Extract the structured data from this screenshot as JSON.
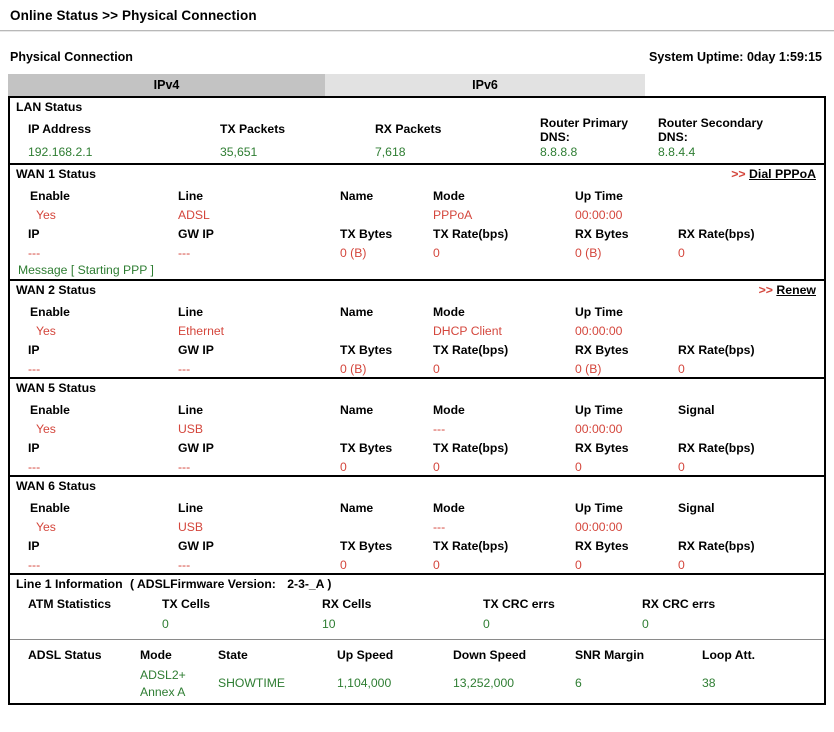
{
  "breadcrumb": "Online Status >> Physical Connection",
  "header": {
    "section_title": "Physical Connection",
    "uptime_label": "System Uptime: 0day 1:59:15"
  },
  "tabs": [
    {
      "label": "IPv4",
      "active": true
    },
    {
      "label": "IPv6",
      "active": false
    }
  ],
  "lan": {
    "title": "LAN Status",
    "headers": {
      "ip": "IP Address",
      "tx_packets": "TX Packets",
      "rx_packets": "RX Packets",
      "dns1": "Router Primary DNS:",
      "dns2": "Router Secondary DNS:"
    },
    "values": {
      "ip": "192.168.2.1",
      "tx_packets": "35,651",
      "rx_packets": "7,618",
      "dns1": "8.8.8.8",
      "dns2": "8.8.4.4"
    }
  },
  "wan1": {
    "title": "WAN 1 Status",
    "link_arrows": ">>",
    "link_text": "Dial PPPoA",
    "headers": {
      "enable": "Enable",
      "line": "Line",
      "name": "Name",
      "mode": "Mode",
      "uptime": "Up Time",
      "ip": "IP",
      "gwip": "GW IP",
      "tx_bytes": "TX Bytes",
      "tx_rate": "TX Rate(bps)",
      "rx_bytes": "RX Bytes",
      "rx_rate": "RX Rate(bps)"
    },
    "values": {
      "enable": "Yes",
      "line": "ADSL",
      "name": "",
      "mode": "PPPoA",
      "uptime": "00:00:00",
      "ip": "---",
      "gwip": "---",
      "tx_bytes": "0 (B)",
      "tx_rate": "0",
      "rx_bytes": "0 (B)",
      "rx_rate": "0"
    },
    "message": "Message [ Starting PPP ]"
  },
  "wan2": {
    "title": "WAN 2 Status",
    "link_arrows": ">>",
    "link_text": "Renew",
    "headers": {
      "enable": "Enable",
      "line": "Line",
      "name": "Name",
      "mode": "Mode",
      "uptime": "Up Time",
      "ip": "IP",
      "gwip": "GW IP",
      "tx_bytes": "TX Bytes",
      "tx_rate": "TX Rate(bps)",
      "rx_bytes": "RX Bytes",
      "rx_rate": "RX Rate(bps)"
    },
    "values": {
      "enable": "Yes",
      "line": "Ethernet",
      "name": "",
      "mode": "DHCP Client",
      "uptime": "00:00:00",
      "ip": "---",
      "gwip": "---",
      "tx_bytes": "0 (B)",
      "tx_rate": "0",
      "rx_bytes": "0 (B)",
      "rx_rate": "0"
    }
  },
  "wan5": {
    "title": "WAN 5 Status",
    "headers": {
      "enable": "Enable",
      "line": "Line",
      "name": "Name",
      "mode": "Mode",
      "uptime": "Up Time",
      "signal": "Signal",
      "ip": "IP",
      "gwip": "GW IP",
      "tx_bytes": "TX Bytes",
      "tx_rate": "TX Rate(bps)",
      "rx_bytes": "RX Bytes",
      "rx_rate": "RX Rate(bps)"
    },
    "values": {
      "enable": "Yes",
      "line": "USB",
      "name": "",
      "mode": "---",
      "uptime": "00:00:00",
      "signal": "",
      "ip": "---",
      "gwip": "---",
      "tx_bytes": "0",
      "tx_rate": "0",
      "rx_bytes": "0",
      "rx_rate": "0"
    }
  },
  "wan6": {
    "title": "WAN 6 Status",
    "headers": {
      "enable": "Enable",
      "line": "Line",
      "name": "Name",
      "mode": "Mode",
      "uptime": "Up Time",
      "signal": "Signal",
      "ip": "IP",
      "gwip": "GW IP",
      "tx_bytes": "TX Bytes",
      "tx_rate": "TX Rate(bps)",
      "rx_bytes": "RX Bytes",
      "rx_rate": "RX Rate(bps)"
    },
    "values": {
      "enable": "Yes",
      "line": "USB",
      "name": "",
      "mode": "---",
      "uptime": "00:00:00",
      "signal": "",
      "ip": "---",
      "gwip": "---",
      "tx_bytes": "0",
      "tx_rate": "0",
      "rx_bytes": "0",
      "rx_rate": "0"
    }
  },
  "line1": {
    "title": "Line 1 Information",
    "firmware_note": "( ADSLFirmware Version:",
    "firmware_version": "2-3-_A )",
    "atm_label": "ATM Statistics",
    "headers": {
      "tx_cells": "TX Cells",
      "rx_cells": "RX Cells",
      "tx_crc": "TX CRC errs",
      "rx_crc": "RX CRC errs"
    },
    "values": {
      "tx_cells": "0",
      "rx_cells": "10",
      "tx_crc": "0",
      "rx_crc": "0"
    }
  },
  "adsl": {
    "label": "ADSL Status",
    "headers": {
      "mode": "Mode",
      "state": "State",
      "up_speed": "Up Speed",
      "down_speed": "Down Speed",
      "snr": "SNR Margin",
      "loop": "Loop Att."
    },
    "values": {
      "mode_line1": "ADSL2+",
      "mode_line2": "Annex A",
      "state": "SHOWTIME",
      "up_speed": "1,104,000",
      "down_speed": "13,252,000",
      "snr": "6",
      "loop": "38"
    }
  },
  "colors": {
    "value_red": "#d4463c",
    "value_green": "#2e7d32",
    "tab_active": "#c3c3c3",
    "tab_inactive": "#e2e2e2",
    "border": "#000000"
  }
}
